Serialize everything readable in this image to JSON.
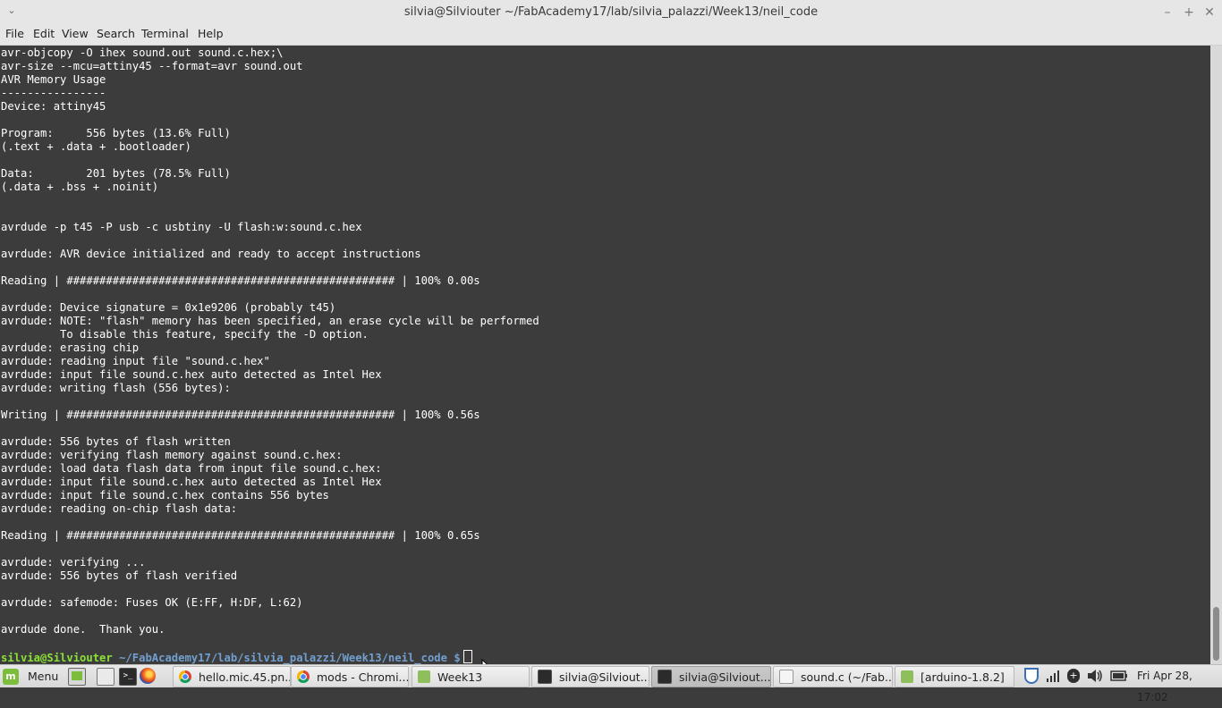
{
  "window": {
    "title": "silvia@Silviouter ~/FabAcademy17/lab/silvia_palazzi/Week13/neil_code"
  },
  "menubar": {
    "items": [
      "File",
      "Edit",
      "View",
      "Search",
      "Terminal",
      "Help"
    ]
  },
  "terminal": {
    "lines": [
      "avr-objcopy -O ihex sound.out sound.c.hex;\\",
      "avr-size --mcu=attiny45 --format=avr sound.out",
      "AVR Memory Usage",
      "----------------",
      "Device: attiny45",
      "",
      "Program:     556 bytes (13.6% Full)",
      "(.text + .data + .bootloader)",
      "",
      "Data:        201 bytes (78.5% Full)",
      "(.data + .bss + .noinit)",
      "",
      "",
      "avrdude -p t45 -P usb -c usbtiny -U flash:w:sound.c.hex",
      "",
      "avrdude: AVR device initialized and ready to accept instructions",
      "",
      "Reading | ################################################## | 100% 0.00s",
      "",
      "avrdude: Device signature = 0x1e9206 (probably t45)",
      "avrdude: NOTE: \"flash\" memory has been specified, an erase cycle will be performed",
      "         To disable this feature, specify the -D option.",
      "avrdude: erasing chip",
      "avrdude: reading input file \"sound.c.hex\"",
      "avrdude: input file sound.c.hex auto detected as Intel Hex",
      "avrdude: writing flash (556 bytes):",
      "",
      "Writing | ################################################## | 100% 0.56s",
      "",
      "avrdude: 556 bytes of flash written",
      "avrdude: verifying flash memory against sound.c.hex:",
      "avrdude: load data flash data from input file sound.c.hex:",
      "avrdude: input file sound.c.hex auto detected as Intel Hex",
      "avrdude: input file sound.c.hex contains 556 bytes",
      "avrdude: reading on-chip flash data:",
      "",
      "Reading | ################################################## | 100% 0.65s",
      "",
      "avrdude: verifying ...",
      "avrdude: 556 bytes of flash verified",
      "",
      "avrdude: safemode: Fuses OK (E:FF, H:DF, L:62)",
      "",
      "avrdude done.  Thank you.",
      ""
    ],
    "prompt": {
      "user": "silvia@Silviouter",
      "path": "~/FabAcademy17/lab/silvia_palazzi/Week13/neil_code",
      "symbol": "$"
    },
    "colors": {
      "background": "#3c3c3c",
      "text": "#ffffff",
      "prompt_user": "#8ae234",
      "prompt_path": "#729fcf"
    }
  },
  "taskbar": {
    "menu_label": "Menu",
    "launchers": [
      "show-desktop-icon",
      "terminal-launcher-icon",
      "firefox-icon"
    ],
    "windows": [
      {
        "label": "hello.mic.45.pn...",
        "icon": "chromium-icon"
      },
      {
        "label": "mods - Chromi...",
        "icon": "chromium-icon"
      },
      {
        "label": "Week13",
        "icon": "folder-icon"
      },
      {
        "label": "silvia@Silviout...",
        "icon": "terminal-icon"
      },
      {
        "label": "silvia@Silviout...",
        "icon": "terminal-icon",
        "active": true
      },
      {
        "label": "sound.c (~/Fab...",
        "icon": "text-editor-icon"
      },
      {
        "label": "[arduino-1.8.2]",
        "icon": "folder-icon"
      }
    ],
    "clock": "Fri Apr 28, 17:02"
  }
}
